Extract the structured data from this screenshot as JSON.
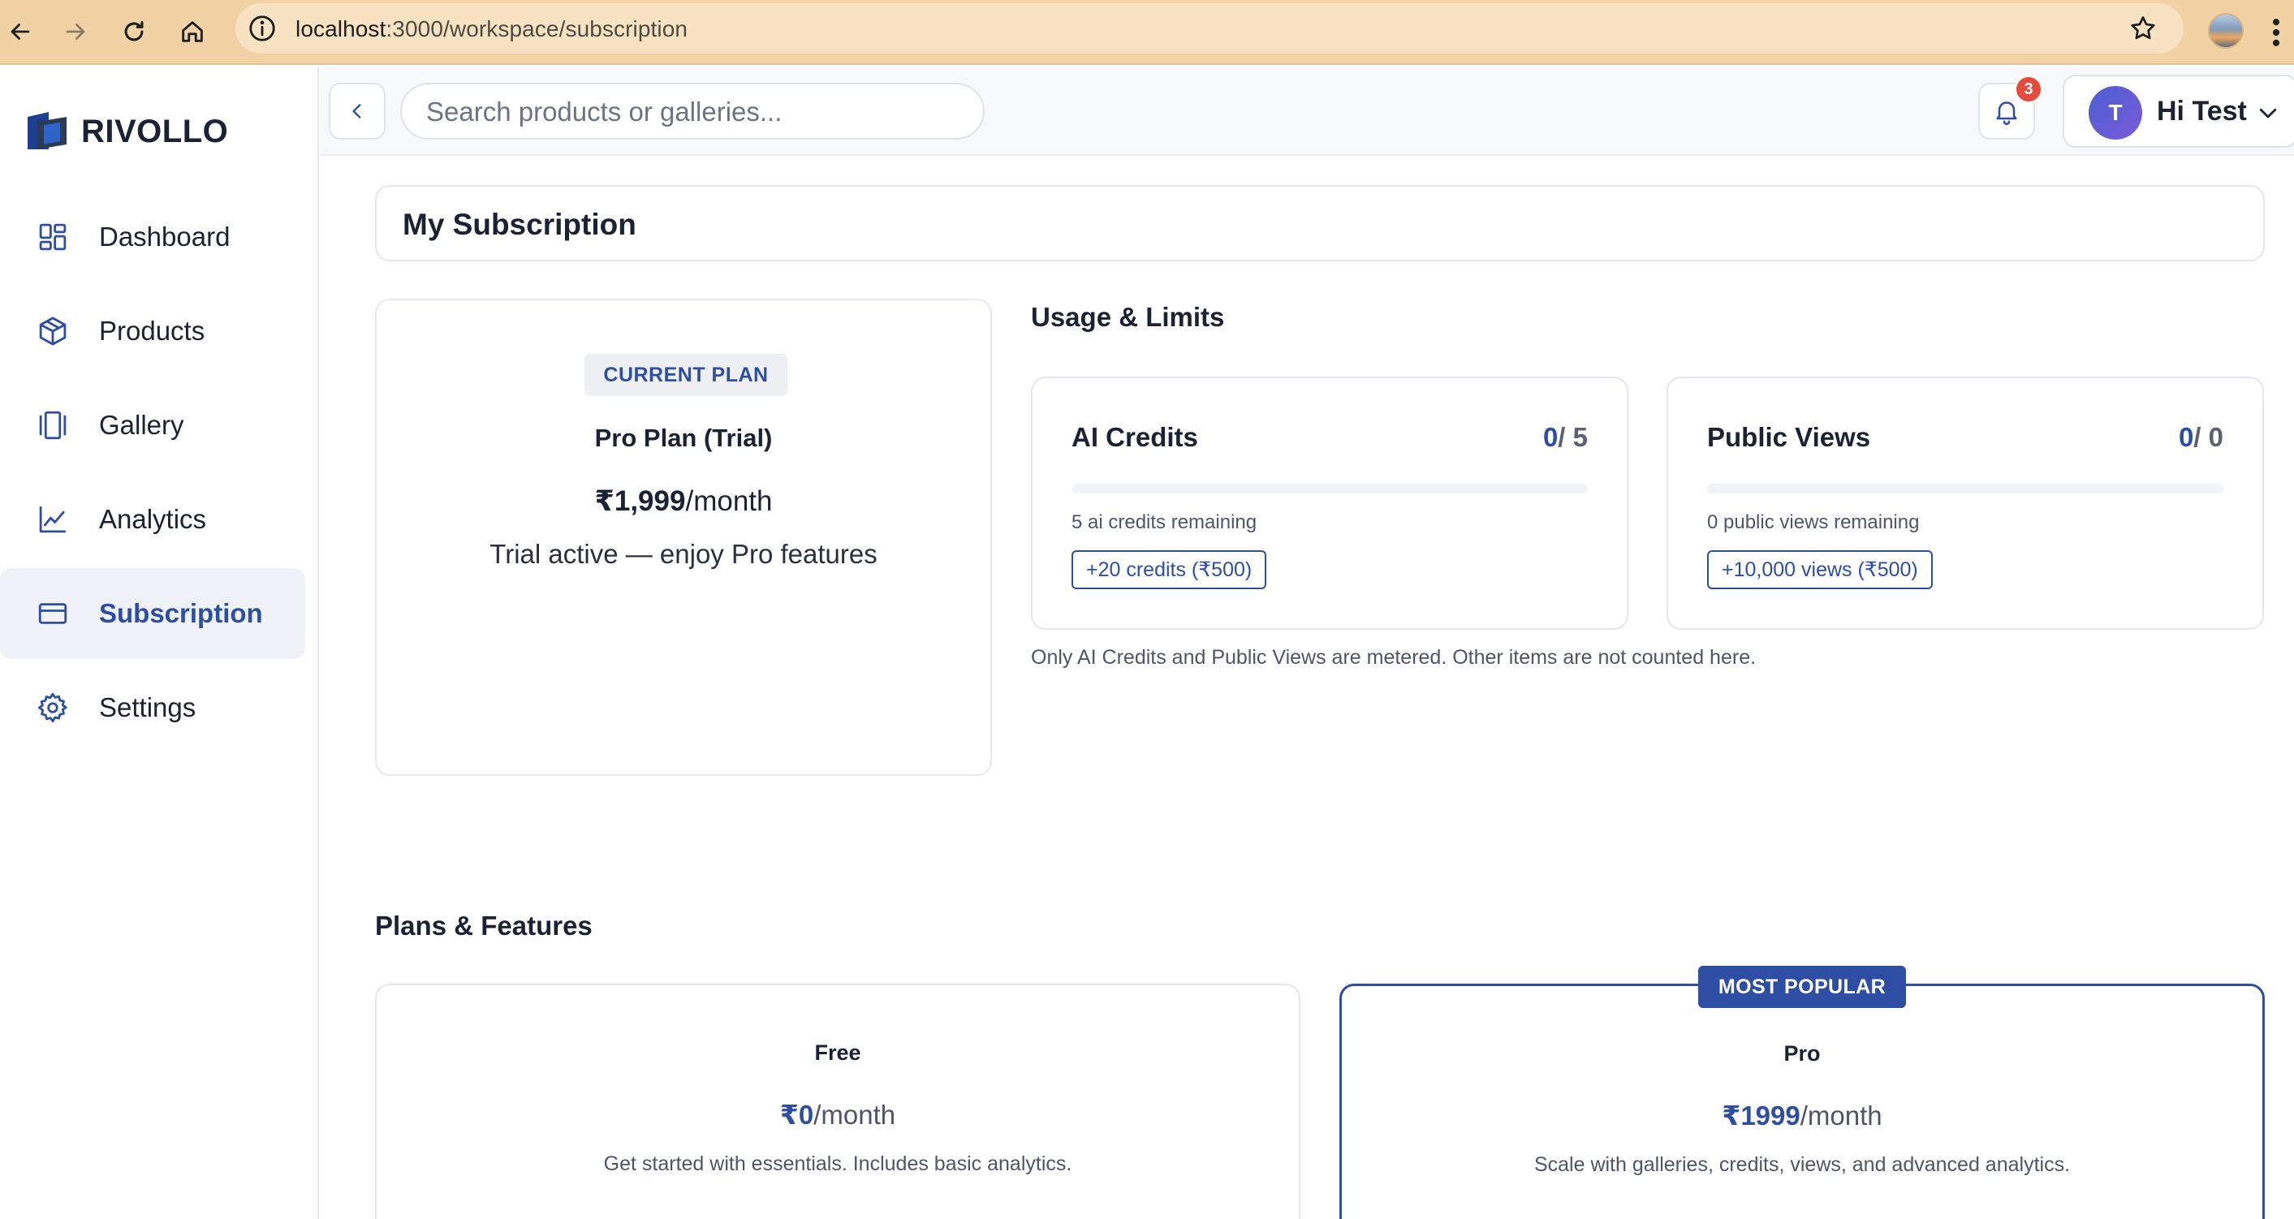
{
  "browser": {
    "url_host": "localhost",
    "url_path": ":3000/workspace/subscription"
  },
  "brand": {
    "name": "RIVOLLO"
  },
  "sidebar": {
    "items": [
      {
        "label": "Dashboard",
        "icon": "dashboard-icon",
        "active": false
      },
      {
        "label": "Products",
        "icon": "box-icon",
        "active": false
      },
      {
        "label": "Gallery",
        "icon": "gallery-icon",
        "active": false
      },
      {
        "label": "Analytics",
        "icon": "chart-line-icon",
        "active": false
      },
      {
        "label": "Subscription",
        "icon": "credit-card-icon",
        "active": true
      },
      {
        "label": "Settings",
        "icon": "gear-icon",
        "active": false
      }
    ]
  },
  "header": {
    "search_placeholder": "Search products or galleries...",
    "notification_count": "3",
    "avatar_initial": "T",
    "greeting": "Hi Test"
  },
  "page": {
    "title": "My Subscription"
  },
  "current_plan": {
    "badge": "CURRENT PLAN",
    "name": "Pro Plan (Trial)",
    "price": "₹1,999",
    "period": "/month",
    "note": "Trial active — enjoy Pro features"
  },
  "usage": {
    "title": "Usage & Limits",
    "cards": [
      {
        "title": "AI Credits",
        "used": "0",
        "limit": "/ 5",
        "fraction": 0,
        "remaining": "5 ai credits remaining",
        "button": "+20 credits (₹500)"
      },
      {
        "title": "Public Views",
        "used": "0",
        "limit": "/ 0",
        "fraction": 0,
        "remaining": "0 public views remaining",
        "button": "+10,000 views (₹500)"
      }
    ],
    "footnote": "Only AI Credits and Public Views are metered. Other items are not counted here."
  },
  "plans": {
    "title": "Plans & Features",
    "tiers": [
      {
        "name": "Free",
        "price": "₹0",
        "period": "/month",
        "description": "Get started with essentials. Includes basic analytics.",
        "badge": ""
      },
      {
        "name": "Pro",
        "price": "₹1999",
        "period": "/month",
        "description": "Scale with galleries, credits, views, and advanced analytics.",
        "badge": "MOST POPULAR"
      }
    ]
  },
  "colors": {
    "accent": "#2d4ea3",
    "browser_bar": "#f0d2a5",
    "badge_red": "#e74a3b"
  }
}
